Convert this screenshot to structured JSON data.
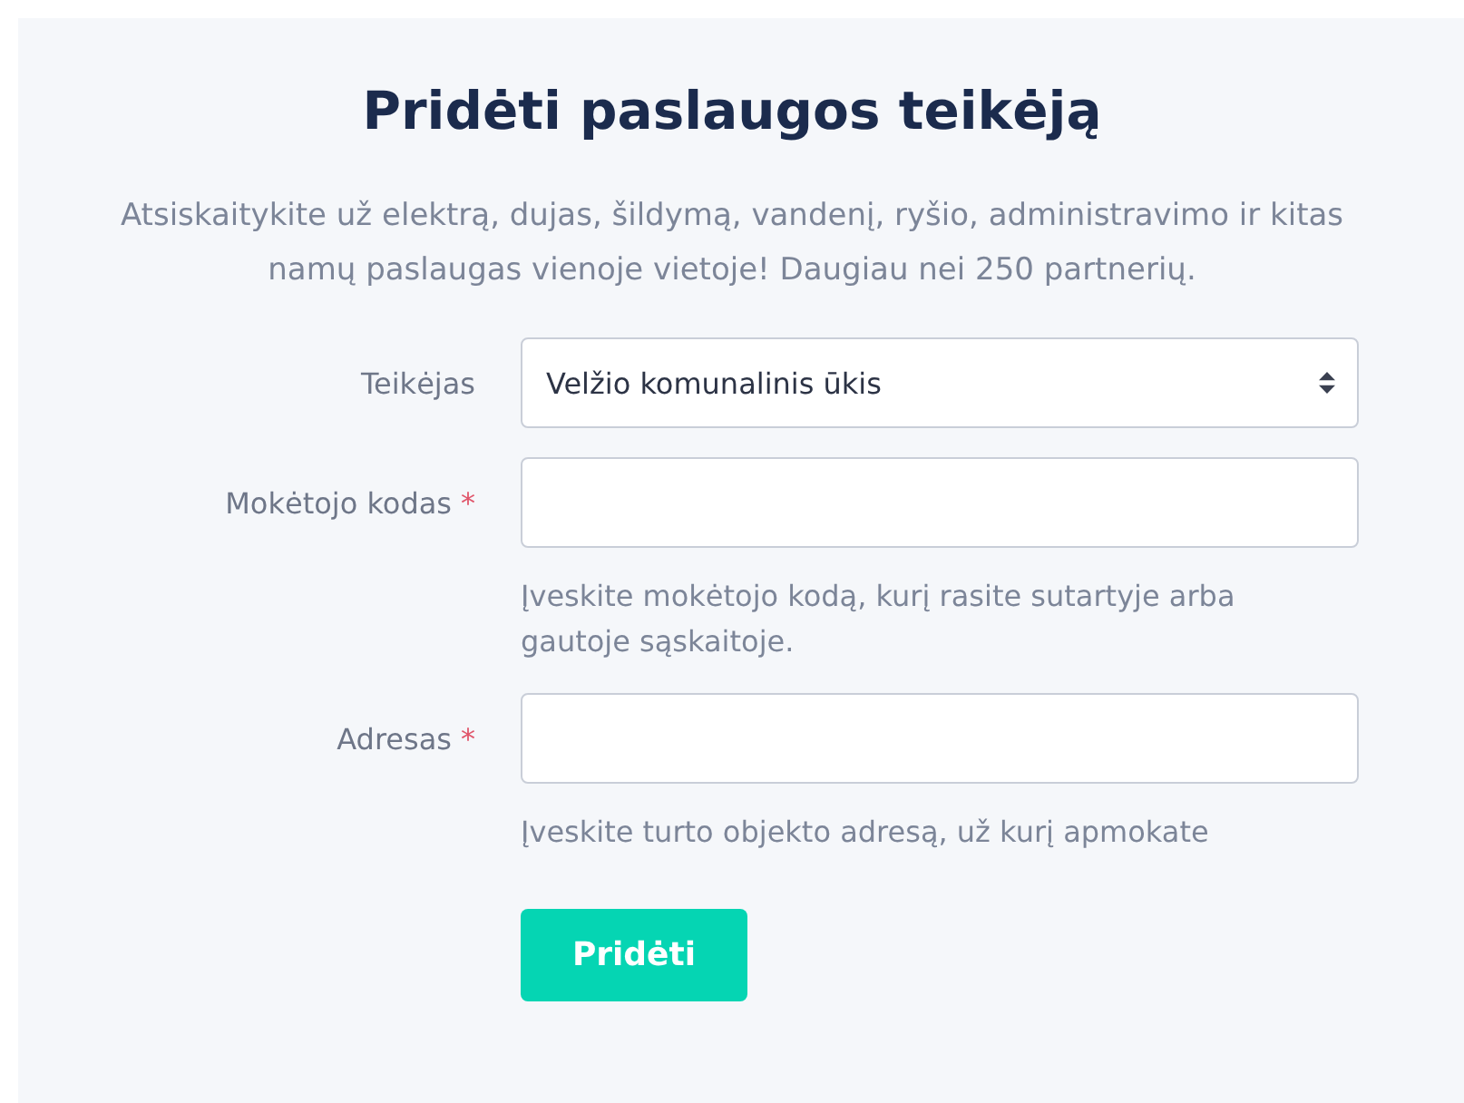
{
  "title": "Pridėti paslaugos teikėją",
  "description": "Atsiskaitykite už elektrą, dujas, šildymą, vandenį, ryšio, administravimo ir kitas namų paslaugas vienoje vietoje! Daugiau nei 250 partnerių.",
  "fields": [
    {
      "kind": "select",
      "label": "Teikėjas",
      "value": "Velžio komunalinis ūkis"
    },
    {
      "kind": "text",
      "label": "Mokėtojo kodas",
      "required_mark": "*",
      "help": "Įveskite mokėtojo kodą, kurį rasite sutartyje arba gautoje sąskaitoje."
    },
    {
      "kind": "text",
      "label": "Adresas",
      "required_mark": "*",
      "help": "Įveskite turto objekto adresą, už kurį apmokate"
    }
  ],
  "submit": "Pridėti"
}
